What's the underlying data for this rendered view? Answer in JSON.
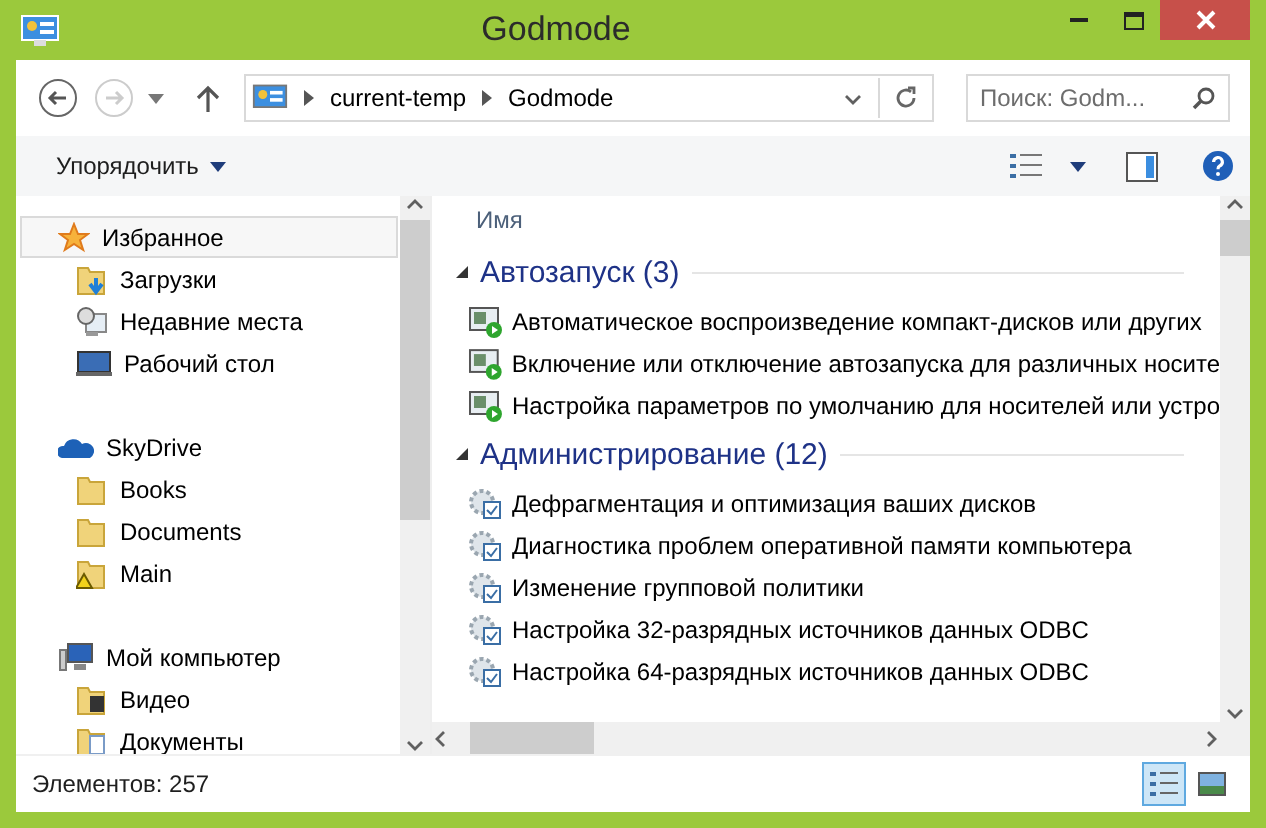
{
  "window": {
    "title": "Godmode"
  },
  "address": {
    "crumbs": [
      "current-temp",
      "Godmode"
    ],
    "search_placeholder": "Поиск: Godm..."
  },
  "toolbar": {
    "organize": "Упорядочить"
  },
  "sidebar": {
    "groups": [
      {
        "label": "Избранное",
        "kind": "star",
        "selected": true,
        "children": [
          {
            "label": "Загрузки",
            "kind": "downloads"
          },
          {
            "label": "Недавние места",
            "kind": "recent"
          },
          {
            "label": "Рабочий стол",
            "kind": "desktop"
          }
        ]
      },
      {
        "label": "SkyDrive",
        "kind": "cloud",
        "selected": false,
        "children": [
          {
            "label": "Books",
            "kind": "folder"
          },
          {
            "label": "Documents",
            "kind": "folder"
          },
          {
            "label": "Main",
            "kind": "warning"
          }
        ]
      },
      {
        "label": "Мой компьютер",
        "kind": "computer",
        "selected": false,
        "children": [
          {
            "label": "Видео",
            "kind": "video"
          },
          {
            "label": "Документы",
            "kind": "docs"
          }
        ]
      }
    ]
  },
  "content": {
    "column": "Имя",
    "groups": [
      {
        "title": "Автозапуск (3)",
        "kind": "autoplay",
        "items": [
          "Автоматическое воспроизведение компакт-дисков или других",
          "Включение или отключение автозапуска для различных носите",
          "Настройка параметров по умолчанию для носителей или устро"
        ]
      },
      {
        "title": "Администрирование (12)",
        "kind": "admin",
        "items": [
          "Дефрагментация и оптимизация ваших дисков",
          "Диагностика проблем оперативной памяти компьютера",
          "Изменение групповой политики",
          "Настройка 32-разрядных источников данных ODBC",
          "Настройка 64-разрядных источников данных ODBC"
        ]
      }
    ]
  },
  "status_bar": {
    "count": "Элементов: 257",
    "views": [
      {
        "kind": "details",
        "selected": true
      },
      {
        "kind": "tiles",
        "selected": false
      }
    ]
  }
}
